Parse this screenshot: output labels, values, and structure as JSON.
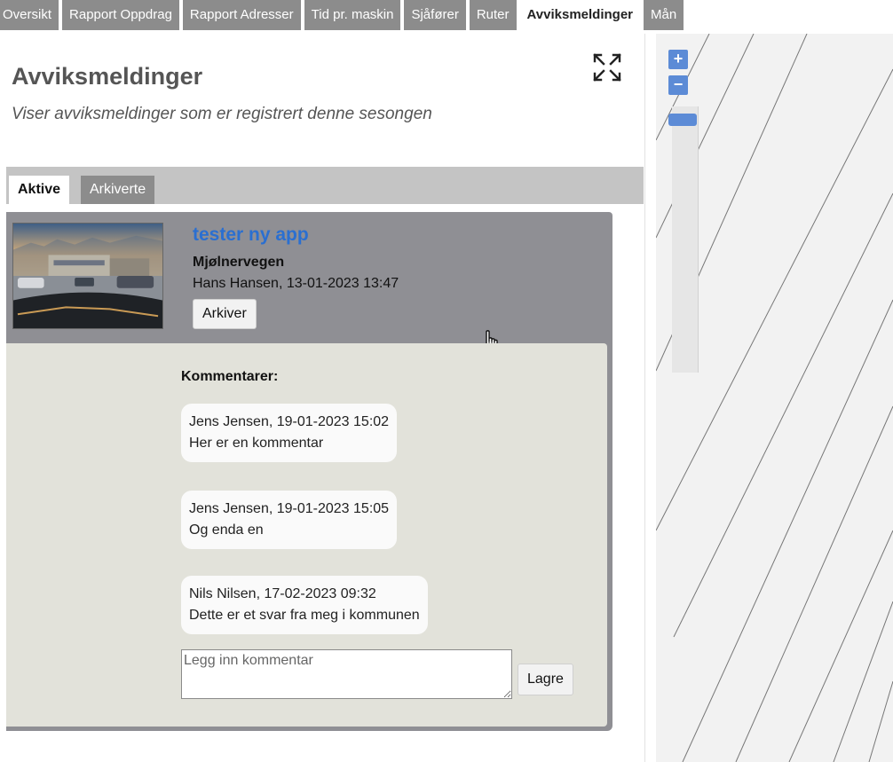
{
  "top_tabs": [
    {
      "label": "Oversikt",
      "active": false
    },
    {
      "label": "Rapport Oppdrag",
      "active": false
    },
    {
      "label": "Rapport Adresser",
      "active": false
    },
    {
      "label": "Tid pr. maskin",
      "active": false
    },
    {
      "label": "Sjåfører",
      "active": false
    },
    {
      "label": "Ruter",
      "active": false
    },
    {
      "label": "Avviksmeldinger",
      "active": true
    },
    {
      "label": "Mån",
      "active": false
    }
  ],
  "page": {
    "title": "Avviksmeldinger",
    "subtitle": "Viser avviksmeldinger som er registrert denne sesongen",
    "expand_icon": "expand-arrows-icon"
  },
  "sub_tabs": {
    "active": "Aktive",
    "archived": "Arkiverte"
  },
  "report": {
    "title": "tester ny app",
    "address": "Mjølnervegen",
    "meta": "Hans Hansen, 13-01-2023 13:47",
    "archive_label": "Arkiver",
    "thumbnail": "car-dashboard-photo"
  },
  "comments": {
    "label": "Kommentarer:",
    "items": [
      {
        "author_time": "Jens Jensen, 19-01-2023 15:02",
        "text": "Her er en kommentar"
      },
      {
        "author_time": "Jens Jensen, 19-01-2023 15:05",
        "text": "Og enda en"
      },
      {
        "author_time": "Nils Nilsen, 17-02-2023 09:32",
        "text": "Dette er et svar fra meg i kommunen"
      }
    ],
    "input_placeholder": "Legg inn kommentar",
    "save_label": "Lagre"
  },
  "map": {
    "zoom_in": "+",
    "zoom_out": "−"
  },
  "colors": {
    "tab_bg": "#8c8c8c",
    "link_blue": "#2a6fd1",
    "card_bg": "#8f8f94",
    "comments_bg": "#e2e2da",
    "zoom_blue": "#5c8bd6"
  }
}
